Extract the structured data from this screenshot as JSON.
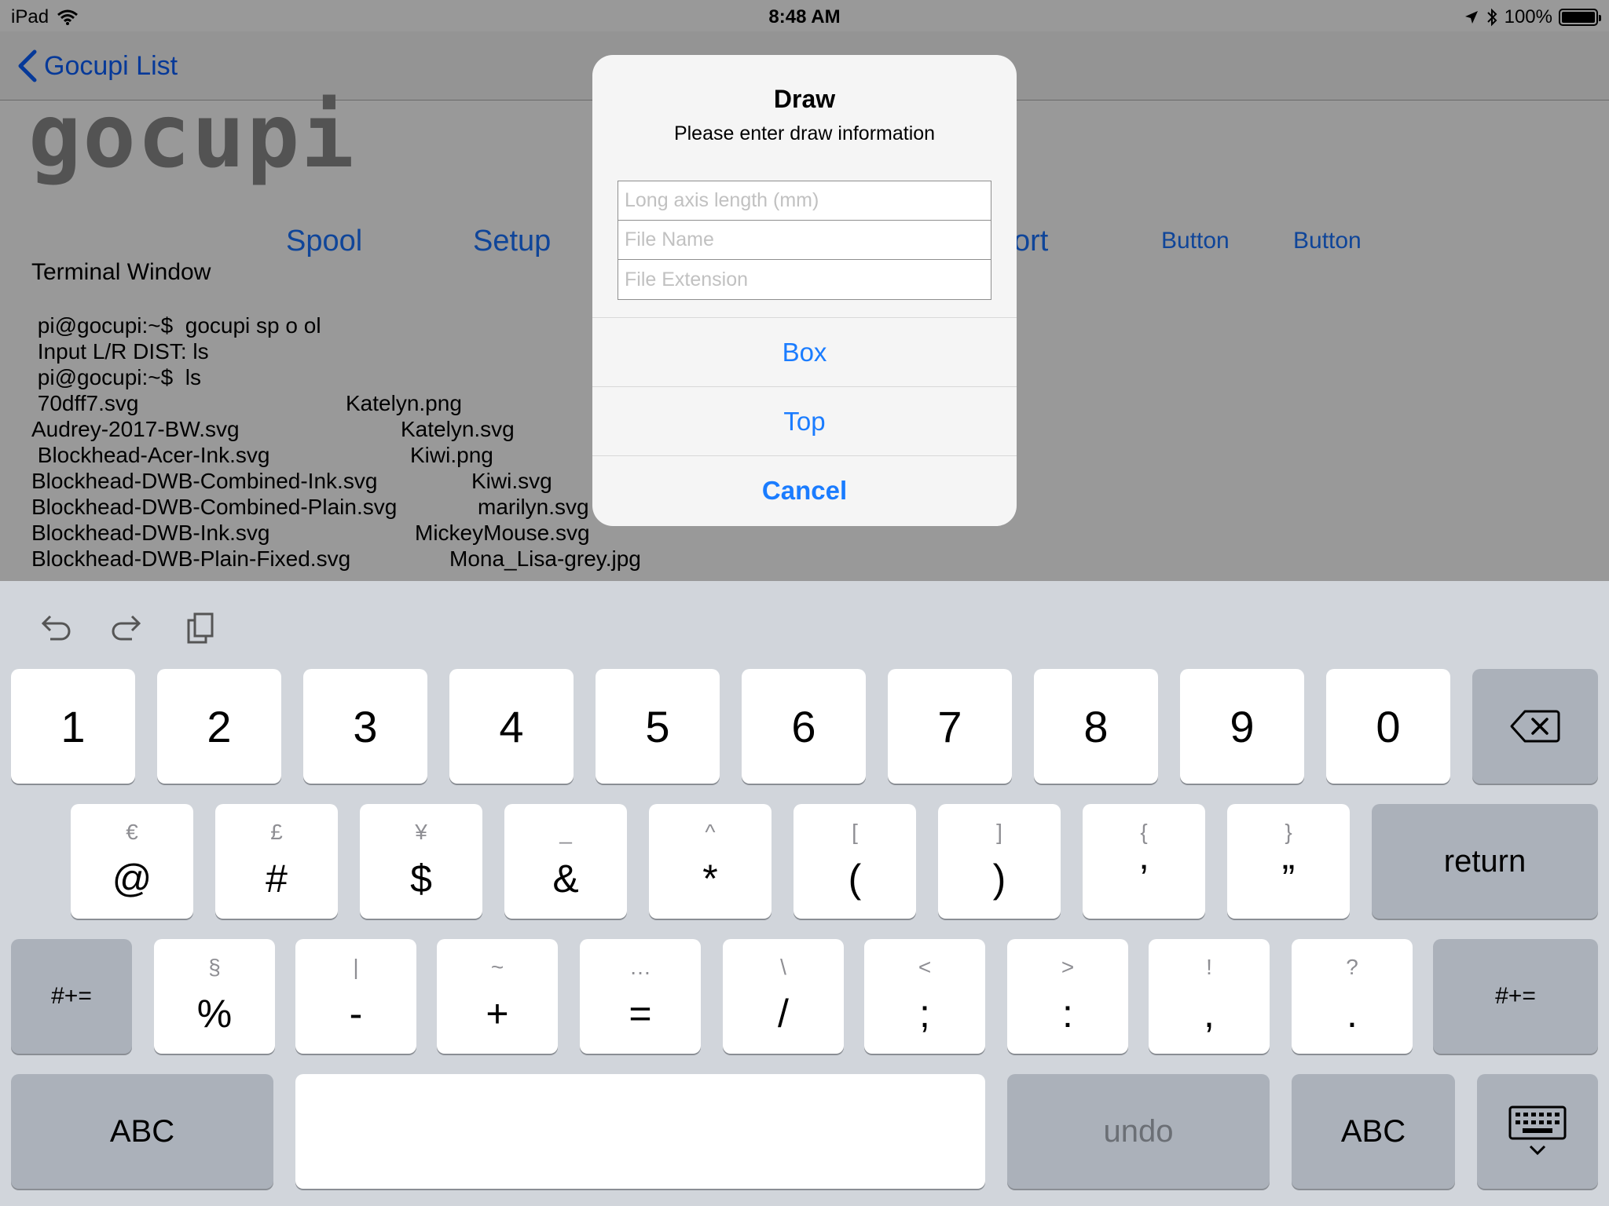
{
  "status_bar": {
    "device": "iPad",
    "time": "8:48 AM",
    "battery": "100%",
    "battery_level": 1.0
  },
  "nav": {
    "back_label": "Gocupi List"
  },
  "logo": "gocupi",
  "tabs": {
    "spool": "Spool",
    "setup": "Setup",
    "port_fragment": "ort",
    "button1": "Button",
    "button2": "Button"
  },
  "terminal": {
    "title": "Terminal Window",
    "lines": [
      {
        "a": " pi@gocupi:~$  gocupi sp o ol",
        "b": ""
      },
      {
        "a": " Input L/R DIST: ls",
        "b": ""
      },
      {
        "a": " pi@gocupi:~$  ls",
        "b": ""
      },
      {
        "a": " 70dff7.svg",
        "b": "Katelyn.png"
      },
      {
        "a": "Audrey-2017-BW.svg",
        "b": "Katelyn.svg"
      },
      {
        "a": " Blockhead-Acer-Ink.svg",
        "b": "Kiwi.png"
      },
      {
        "a": "Blockhead-DWB-Combined-Ink.svg",
        "b": "Kiwi.svg"
      },
      {
        "a": "Blockhead-DWB-Combined-Plain.svg",
        "b": "marilyn.svg"
      },
      {
        "a": "Blockhead-DWB-Ink.svg",
        "b": "MickeyMouse.svg"
      },
      {
        "a": "Blockhead-DWB-Plain-Fixed.svg",
        "b": "Mona_Lisa-grey.jpg"
      }
    ]
  },
  "alert": {
    "title": "Draw",
    "message": "Please enter draw information",
    "fields": [
      {
        "placeholder": "Long axis length (mm)",
        "value": ""
      },
      {
        "placeholder": "File Name",
        "value": ""
      },
      {
        "placeholder": "File Extension",
        "value": ""
      }
    ],
    "actions": {
      "box": "Box",
      "top": "Top",
      "cancel": "Cancel"
    }
  },
  "keyboard": {
    "row1": [
      "1",
      "2",
      "3",
      "4",
      "5",
      "6",
      "7",
      "8",
      "9",
      "0"
    ],
    "row2": [
      {
        "sec": "€",
        "prim": "@"
      },
      {
        "sec": "£",
        "prim": "#"
      },
      {
        "sec": "¥",
        "prim": "$"
      },
      {
        "sec": "_",
        "prim": "&"
      },
      {
        "sec": "^",
        "prim": "*"
      },
      {
        "sec": "[",
        "prim": "("
      },
      {
        "sec": "]",
        "prim": ")"
      },
      {
        "sec": "{",
        "prim": "’"
      },
      {
        "sec": "}",
        "prim": "”"
      }
    ],
    "return_label": "return",
    "row3": [
      {
        "sec": "§",
        "prim": "%"
      },
      {
        "sec": "|",
        "prim": "-"
      },
      {
        "sec": "~",
        "prim": "+"
      },
      {
        "sec": "…",
        "prim": "="
      },
      {
        "sec": "\\",
        "prim": "/"
      },
      {
        "sec": "<",
        "prim": ";"
      },
      {
        "sec": ">",
        "prim": ":"
      },
      {
        "sec": "!",
        "prim": ","
      },
      {
        "sec": "?",
        "prim": "."
      }
    ],
    "symbols_label": "#+=",
    "abc_label": "ABC",
    "undo_label": "undo",
    "toolbar_icons": [
      "undo-arrow-icon",
      "redo-arrow-icon",
      "clipboard-paste-icon"
    ],
    "backspace_icon": "backspace-icon",
    "dismiss_icon": "keyboard-dismiss-icon"
  },
  "colors": {
    "accent": "#1a7cff",
    "keyboard_bg": "#d1d5db",
    "key_dark": "#abb1ba"
  }
}
